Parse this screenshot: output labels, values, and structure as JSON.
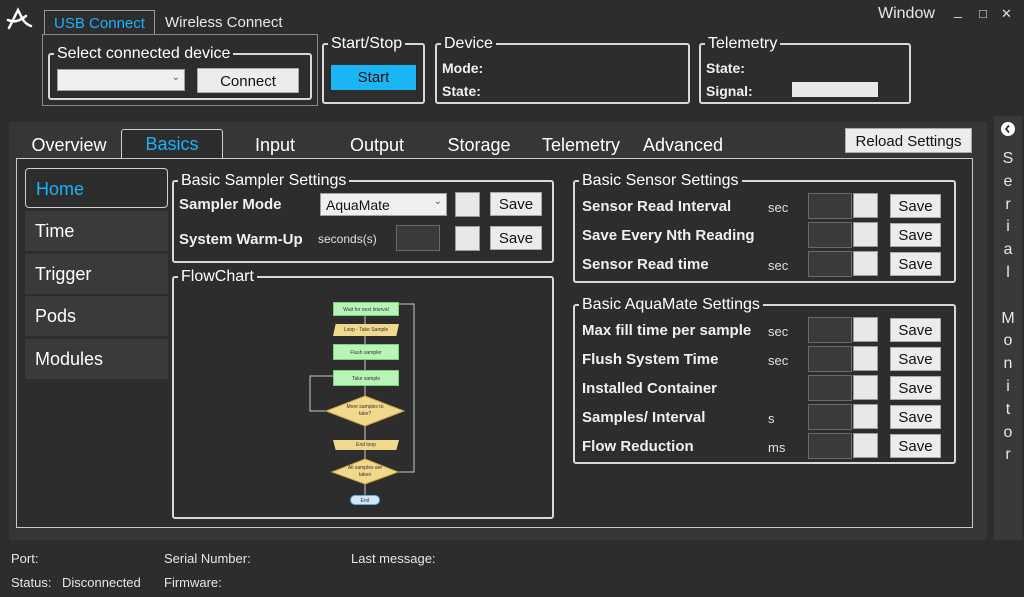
{
  "window": {
    "title": "Window",
    "min": "_",
    "max": "□",
    "close": "✕"
  },
  "connection_tabs": [
    "USB Connect",
    "Wireless Connect"
  ],
  "select_device": {
    "legend": "Select connected device",
    "dropdown_value": "",
    "connect_label": "Connect"
  },
  "start_stop": {
    "legend": "Start/Stop",
    "start_label": "Start"
  },
  "device": {
    "legend": "Device",
    "mode_label": "Mode:",
    "state_label": "State:"
  },
  "telemetry": {
    "legend": "Telemetry",
    "state_label": "State:",
    "signal_label": "Signal:"
  },
  "main_tabs": [
    "Overview",
    "Basics",
    "Input",
    "Output",
    "Storage",
    "Telemetry",
    "Advanced"
  ],
  "reload_label": "Reload Settings",
  "side_nav": [
    "Home",
    "Time",
    "Trigger",
    "Pods",
    "Modules"
  ],
  "sampler": {
    "legend": "Basic Sampler Settings",
    "mode_label": "Sampler Mode",
    "mode_value": "AquaMate",
    "warmup_label": "System Warm-Up",
    "warmup_unit": "seconds(s)",
    "save": "Save"
  },
  "flowchart": {
    "legend": "FlowChart",
    "steps": [
      "Wait for next interval",
      "Loop - Take Sample",
      "Flush sampler",
      "Take sample",
      "More samples to take?",
      "End loop",
      "All samples are taken",
      "End"
    ]
  },
  "sensor": {
    "legend": "Basic Sensor Settings",
    "rows": [
      {
        "label": "Sensor Read Interval",
        "unit": "sec",
        "save": "Save"
      },
      {
        "label": "Save Every Nth Reading",
        "unit": "",
        "save": "Save"
      },
      {
        "label": "Sensor Read time",
        "unit": "sec",
        "save": "Save"
      }
    ]
  },
  "aquamate": {
    "legend": "Basic AquaMate Settings",
    "rows": [
      {
        "label": "Max fill time per sample",
        "unit": "sec",
        "save": "Save"
      },
      {
        "label": "Flush System Time",
        "unit": "sec",
        "save": "Save"
      },
      {
        "label": "Installed Container",
        "unit": "",
        "save": "Save"
      },
      {
        "label": "Samples/ Interval",
        "unit": "s",
        "save": "Save"
      },
      {
        "label": "Flow Reduction",
        "unit": "ms",
        "save": "Save"
      }
    ]
  },
  "serial_monitor": {
    "letters": [
      "S",
      "e",
      "r",
      "i",
      "a",
      "l",
      "",
      "M",
      "o",
      "n",
      "i",
      "t",
      "o",
      "r"
    ]
  },
  "status_bar": {
    "port_label": "Port:",
    "serial_label": "Serial Number:",
    "last_message_label": "Last message:",
    "status_label": "Status:",
    "status_value": "Disconnected",
    "firmware_label": "Firmware:"
  },
  "colors": {
    "accent": "#1ab2ff",
    "start_button": "#19b5f5",
    "background": "#2d2d2d"
  }
}
